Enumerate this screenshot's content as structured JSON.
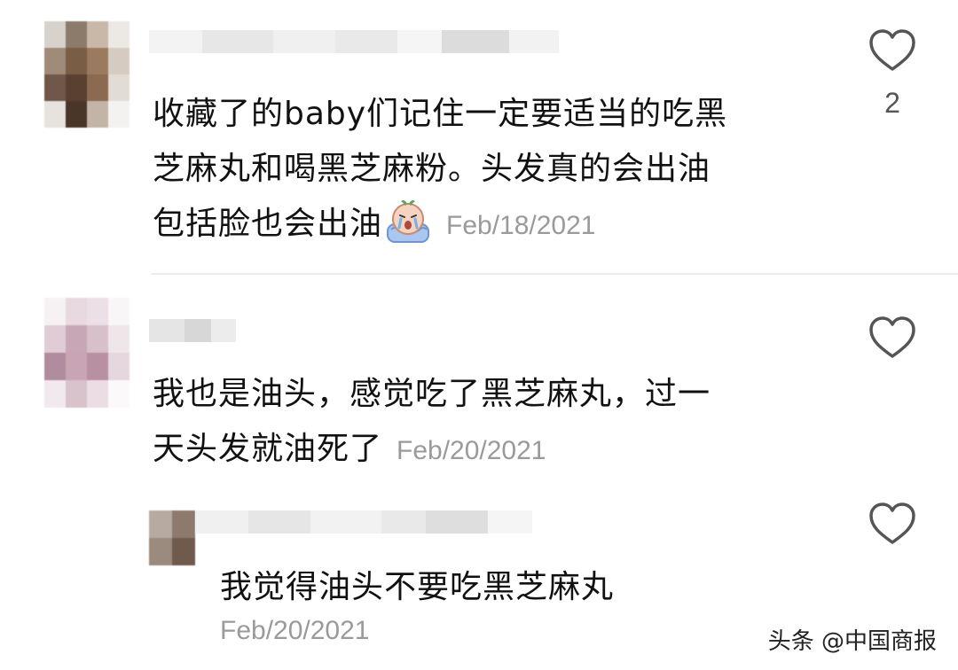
{
  "comments": [
    {
      "lines": [
        "收藏了的baby们记住一定要适当的吃黑",
        "芝麻丸和喝黑芝麻粉。头发真的会出油",
        "包括脸也会出油"
      ],
      "emoji": "crying-face-emoji",
      "date": "Feb/18/2021",
      "likes": "2"
    },
    {
      "lines": [
        "我也是油头，感觉吃了黑芝麻丸，过一",
        "天头发就油死了"
      ],
      "date": "Feb/20/2021"
    },
    {
      "lines": [
        "我觉得油头不要吃黑芝麻丸"
      ],
      "date": "Feb/20/2021"
    }
  ],
  "icons": {
    "like": "heart-outline-icon"
  },
  "colors": {
    "text": "#111111",
    "date": "#9a9a9a",
    "icon": "#555555",
    "divider": "#ececec"
  },
  "watermark": "头条 @中国商报"
}
